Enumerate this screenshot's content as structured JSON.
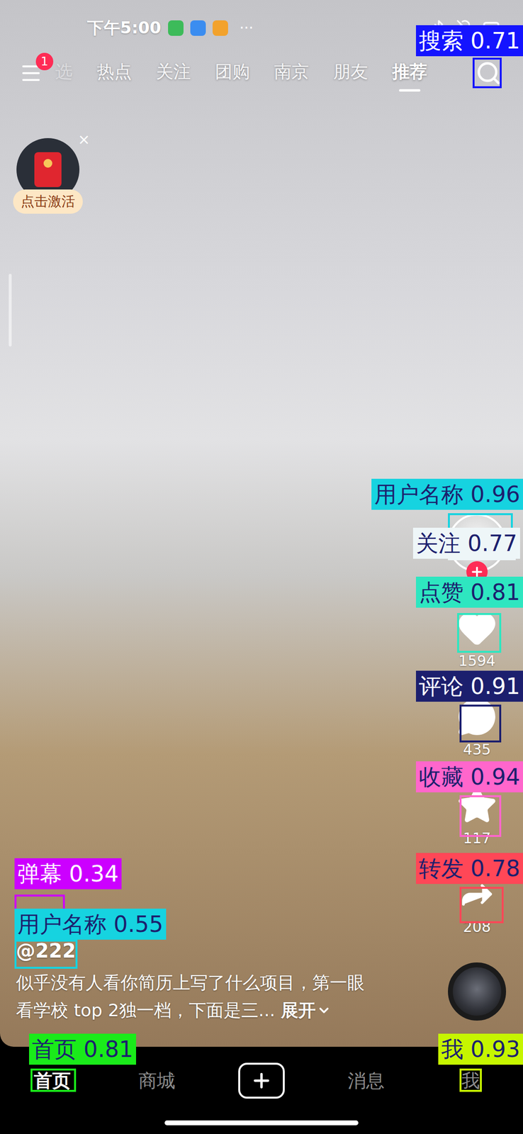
{
  "status_bar": {
    "time": "下午5:00",
    "more": "···"
  },
  "nav": {
    "badge": "1",
    "tabs": [
      {
        "label": "选",
        "selected": false,
        "faded": true
      },
      {
        "label": "热点",
        "selected": false,
        "faded": false
      },
      {
        "label": "关注",
        "selected": false,
        "faded": false
      },
      {
        "label": "团购",
        "selected": false,
        "faded": false
      },
      {
        "label": "南京",
        "selected": false,
        "faded": false
      },
      {
        "label": "朋友",
        "selected": false,
        "faded": false
      },
      {
        "label": "推荐",
        "selected": true,
        "faded": false
      }
    ]
  },
  "promo": {
    "label": "点击激活",
    "close": "×"
  },
  "author": {
    "name": "@222",
    "followed": false
  },
  "actions": [
    {
      "kind": "like",
      "count": "1594"
    },
    {
      "kind": "comment",
      "count": "435"
    },
    {
      "kind": "favorite",
      "count": "117"
    },
    {
      "kind": "share",
      "count": "208"
    }
  ],
  "caption": {
    "text": "似乎没有人看你简历上写了什么项目，第一眼看学校 top 2独一档，下面是三...",
    "more": "展开"
  },
  "bottom_tabs": [
    {
      "kind": "text",
      "label": "首页",
      "selected": true
    },
    {
      "kind": "text",
      "label": "商城",
      "selected": false
    },
    {
      "kind": "create",
      "selected": false
    },
    {
      "kind": "text",
      "label": "消息",
      "selected": false
    },
    {
      "kind": "text",
      "label": "我",
      "selected": false
    }
  ],
  "annotations": [
    {
      "label": "搜索 0.71",
      "color": "#1414ff"
    },
    {
      "label": "用户名称 0.96",
      "color": "#16d3e0"
    },
    {
      "label": "关注 0.77",
      "color": "#eef6f8"
    },
    {
      "label": "点赞 0.81",
      "color": "#2ee6c0"
    },
    {
      "label": "评论 0.91",
      "color": "#1c1f6e"
    },
    {
      "label": "收藏 0.94",
      "color": "#ff66cc"
    },
    {
      "label": "转发 0.78",
      "color": "#ff4757"
    },
    {
      "label": "弹幕 0.34",
      "color": "#cc00ff"
    },
    {
      "label": "用户名称 0.55",
      "color": "#16d3e0"
    },
    {
      "label": "首页 0.81",
      "color": "#1aeb1a"
    },
    {
      "label": "我 0.93",
      "color": "#c6f500"
    }
  ]
}
